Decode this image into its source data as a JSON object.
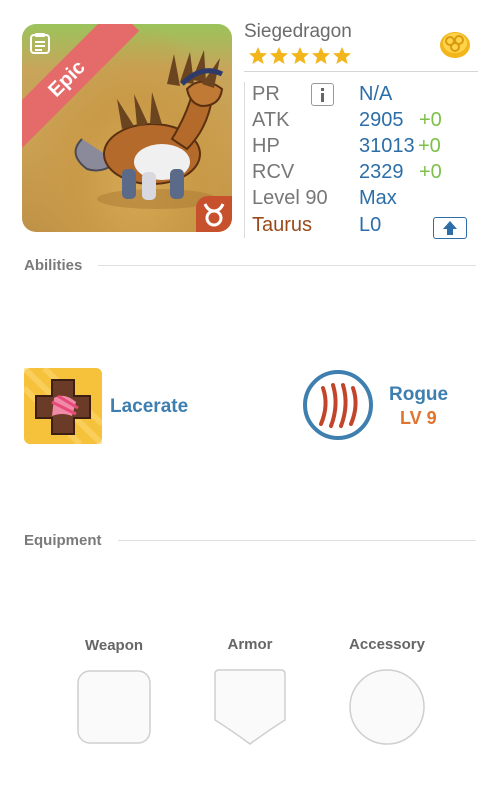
{
  "monster": {
    "name": "Siegedragon",
    "rarity": "Epic",
    "star_count": 5,
    "stats": {
      "pr_label": "PR",
      "pr_value": "N/A",
      "atk_label": "ATK",
      "atk_value": "2905",
      "atk_bonus": "+0",
      "hp_label": "HP",
      "hp_value": "31013",
      "hp_bonus": "+0",
      "rcv_label": "RCV",
      "rcv_value": "2329",
      "rcv_bonus": "+0",
      "level_label": "Level 90",
      "level_value": "Max",
      "zodiac_label": "Taurus",
      "zodiac_value": "L0"
    }
  },
  "abilities": {
    "title": "Abilities",
    "skill": {
      "name": "Lacerate",
      "icon": "lacerate-icon"
    },
    "class": {
      "name": "Rogue",
      "level": "LV 9",
      "icon": "rogue-claw-icon"
    }
  },
  "equipment": {
    "title": "Equipment",
    "slots": [
      {
        "label": "Weapon"
      },
      {
        "label": "Armor"
      },
      {
        "label": "Accessory"
      }
    ]
  },
  "colors": {
    "accent_blue": "#2d6ea8",
    "bonus_green": "#7cc04a",
    "rarity_red": "#e56a6a",
    "star_gold": "#f2b51b",
    "level_orange": "#e0742f"
  }
}
